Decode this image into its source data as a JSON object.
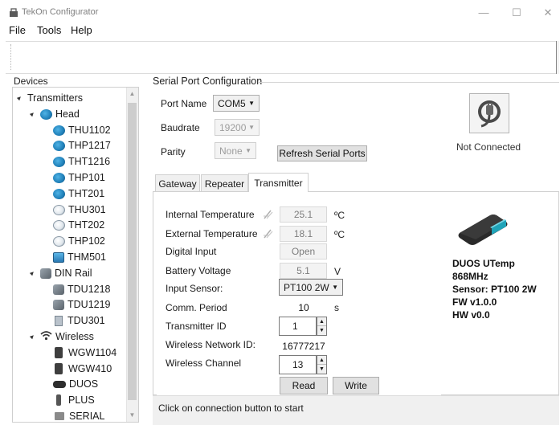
{
  "window": {
    "title": "TekOn Configurator",
    "controls": {
      "minimize": "—",
      "maximize": "☐",
      "close": "✕"
    }
  },
  "menu": {
    "items": [
      "File",
      "Tools",
      "Help"
    ]
  },
  "devices": {
    "label": "Devices",
    "tree": [
      {
        "label": "Transmitters",
        "level": 0,
        "expander": "▲",
        "icon": "transmitter-icon"
      },
      {
        "label": "Head",
        "level": 1,
        "expander": "▲",
        "icon": "head-group-icon"
      },
      {
        "label": "THU1102",
        "level": 2,
        "icon": "blue-sensor-icon"
      },
      {
        "label": "THP1217",
        "level": 2,
        "icon": "blue-sensor-icon"
      },
      {
        "label": "THT1216",
        "level": 2,
        "icon": "blue-sensor-icon"
      },
      {
        "label": "THP101",
        "level": 2,
        "icon": "blue-sensor-icon"
      },
      {
        "label": "THT201",
        "level": 2,
        "icon": "blue-sensor-icon"
      },
      {
        "label": "THU301",
        "level": 2,
        "icon": "white-sensor-icon"
      },
      {
        "label": "THT202",
        "level": 2,
        "icon": "white-sensor-icon"
      },
      {
        "label": "THP102",
        "level": 2,
        "icon": "white-sensor-icon"
      },
      {
        "label": "THM501",
        "level": 2,
        "icon": "square-sensor-icon"
      },
      {
        "label": "DIN Rail",
        "level": 1,
        "expander": "▲",
        "icon": "din-rail-icon"
      },
      {
        "label": "TDU1218",
        "level": 2,
        "icon": "din-device-icon"
      },
      {
        "label": "TDU1219",
        "level": 2,
        "icon": "din-device-icon"
      },
      {
        "label": "TDU301",
        "level": 2,
        "icon": "din-small-icon"
      },
      {
        "label": "Wireless",
        "level": 1,
        "expander": "▲",
        "icon": "wireless-icon"
      },
      {
        "label": "WGW1104",
        "level": 2,
        "icon": "gateway-icon"
      },
      {
        "label": "WGW410",
        "level": 2,
        "icon": "gateway-icon"
      },
      {
        "label": "DUOS",
        "level": 2,
        "icon": "duos-icon"
      },
      {
        "label": "PLUS",
        "level": 2,
        "icon": "plus-icon"
      },
      {
        "label": "SERIAL",
        "level": 2,
        "icon": "serial-icon"
      }
    ]
  },
  "serial": {
    "group_label": "Serial Port Configuration",
    "port_name_label": "Port Name",
    "port_name_value": "COM5",
    "baudrate_label": "Baudrate",
    "baudrate_value": "19200",
    "parity_label": "Parity",
    "parity_value": "None",
    "refresh_label": "Refresh Serial Ports"
  },
  "connection": {
    "status": "Not Connected",
    "icon": "connection-icon"
  },
  "tabs": {
    "items": [
      "Gateway",
      "Repeater",
      "Transmitter"
    ],
    "active": "Transmitter"
  },
  "transmitter": {
    "internal_temp_label": "Internal Temperature",
    "internal_temp_value": "25.1",
    "internal_temp_unit": "ºC",
    "external_temp_label": "External Temperature",
    "external_temp_value": "18.1",
    "external_temp_unit": "ºC",
    "digital_input_label": "Digital Input",
    "digital_input_value": "Open",
    "battery_label": "Battery Voltage",
    "battery_value": "5.1",
    "battery_unit": "V",
    "input_sensor_label": "Input Sensor:",
    "input_sensor_value": "PT100 2W",
    "comm_period_label": "Comm. Period",
    "comm_period_value": "10",
    "comm_period_unit": "s",
    "tx_id_label": "Transmitter ID",
    "tx_id_value": "1",
    "network_id_label": "Wireless Network ID:",
    "network_id_value": "16777217",
    "channel_label": "Wireless Channel",
    "channel_value": "13",
    "read_label": "Read",
    "write_label": "Write"
  },
  "device_info": {
    "lines": [
      "DUOS UTemp",
      "868MHz",
      "Sensor: PT100 2W",
      "FW v1.0.0",
      "HW v0.0"
    ]
  },
  "status": {
    "text": "Click on connection button to start"
  }
}
